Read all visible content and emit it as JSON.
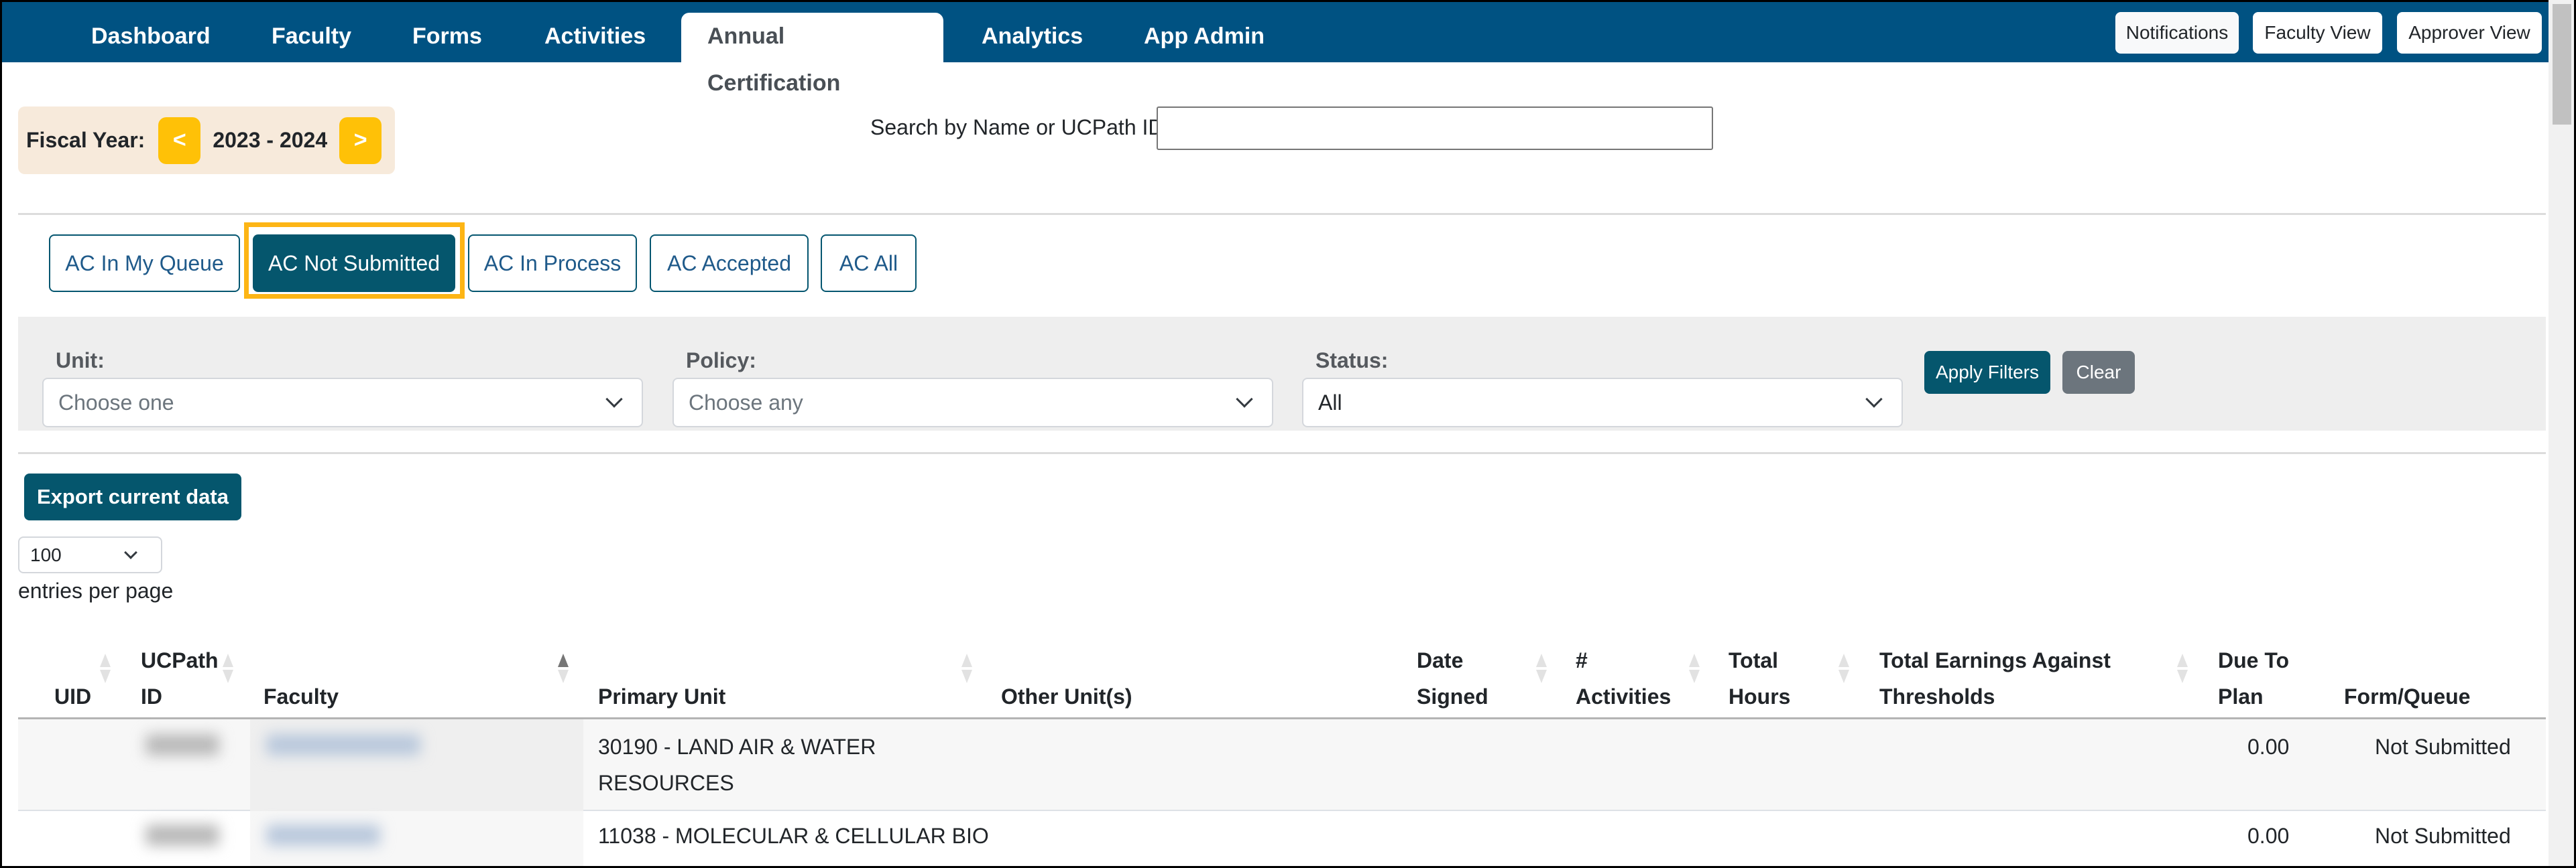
{
  "nav": {
    "items": [
      {
        "label": "Dashboard"
      },
      {
        "label": "Faculty"
      },
      {
        "label": "Forms"
      },
      {
        "label": "Activities"
      },
      {
        "label": "Annual Certification",
        "active": true
      },
      {
        "label": "Analytics"
      },
      {
        "label": "App Admin"
      }
    ],
    "buttons": {
      "notifications": "Notifications",
      "faculty_view": "Faculty View",
      "approver_view": "Approver View"
    }
  },
  "fiscal_year": {
    "label": "Fiscal Year:",
    "prev": "<",
    "value": "2023 - 2024",
    "next": ">"
  },
  "search": {
    "label": "Search by Name or UCPath ID:",
    "value": "",
    "placeholder": ""
  },
  "ac_tabs": [
    {
      "label": "AC In My Queue"
    },
    {
      "label": "AC Not Submitted",
      "active": true
    },
    {
      "label": "AC In Process"
    },
    {
      "label": "AC Accepted"
    },
    {
      "label": "AC All"
    }
  ],
  "filters": {
    "unit": {
      "label": "Unit:",
      "value": "Choose one"
    },
    "policy": {
      "label": "Policy:",
      "value": "Choose any"
    },
    "status": {
      "label": "Status:",
      "value": "All"
    },
    "apply_label": "Apply Filters",
    "clear_label": "Clear"
  },
  "export_label": "Export current data",
  "entries": {
    "value": "100",
    "label": "entries per page"
  },
  "colors": {
    "nav_bg": "#005282",
    "primary": "#05566d",
    "accent_yellow": "#ffc107",
    "highlight": "#fdb515",
    "secondary": "#6c757d"
  },
  "table": {
    "columns": [
      {
        "line1": "",
        "line2": "UID"
      },
      {
        "line1": "UCPath",
        "line2": "ID"
      },
      {
        "line1": "",
        "line2": "Faculty",
        "sorted": "asc"
      },
      {
        "line1": "",
        "line2": "Primary Unit"
      },
      {
        "line1": "",
        "line2": "Other Unit(s)"
      },
      {
        "line1": "Date",
        "line2": "Signed"
      },
      {
        "line1": "#",
        "line2": "Activities"
      },
      {
        "line1": "Total",
        "line2": "Hours"
      },
      {
        "line1": "Total Earnings Against",
        "line2": "Thresholds"
      },
      {
        "line1": "Due To",
        "line2": "Plan"
      },
      {
        "line1": "",
        "line2": "Form/Queue"
      }
    ],
    "rows": [
      {
        "uid": "",
        "ucpath_id": "(redacted)",
        "faculty": "(redacted)",
        "primary_unit_line1": "30190 - LAND AIR & WATER",
        "primary_unit_line2": "RESOURCES",
        "other_units": "",
        "date_signed": "",
        "activities": "",
        "total_hours": "",
        "total_earnings": "",
        "due_to_plan": "0.00",
        "form_queue": "Not Submitted"
      },
      {
        "uid": "",
        "ucpath_id": "(redacted)",
        "faculty": "(redacted)",
        "primary_unit_line1": "11038 - MOLECULAR & CELLULAR BIO",
        "primary_unit_line2": "",
        "other_units": "",
        "date_signed": "",
        "activities": "",
        "total_hours": "",
        "total_earnings": "",
        "due_to_plan": "0.00",
        "form_queue": "Not Submitted"
      }
    ]
  }
}
